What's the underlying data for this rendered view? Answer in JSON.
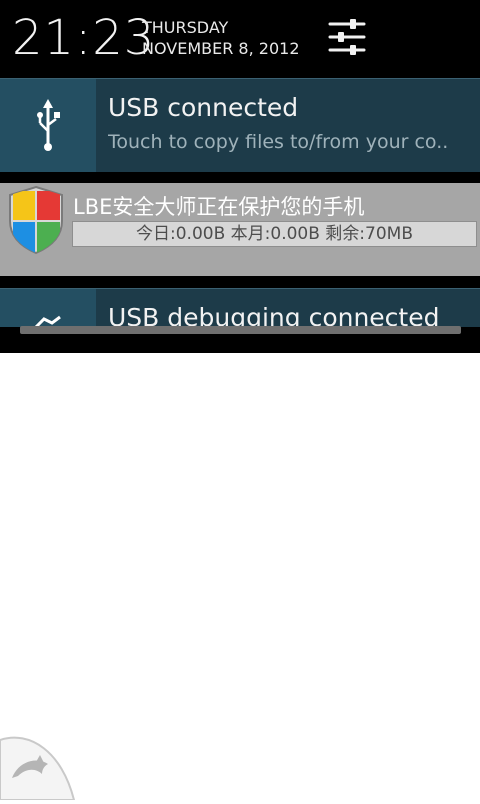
{
  "status_header": {
    "time": "21:23",
    "weekday": "THURSDAY",
    "date": "NOVEMBER 8, 2012",
    "settings_icon": "quick-settings-sliders-icon"
  },
  "notifications": [
    {
      "icon": "usb-icon",
      "title": "USB connected",
      "text": "Touch to copy files to/from your co.."
    },
    {
      "icon": "shield-icon",
      "title": "LBE安全大师正在保护您的手机",
      "text": "今日:0.00B 本月:0.00B 剩余:70MB"
    },
    {
      "icon": "usb-debug-icon",
      "title": "USB debugging connected"
    }
  ],
  "corner_app": {
    "icon": "dolphin-icon"
  },
  "colors": {
    "shade_bg": "#000000",
    "notification_bg": "#1d3b49",
    "notification_icon_bg": "#244f62",
    "lbe_bg": "#a6a6a6",
    "shield_blue": "#1d8fe3",
    "shield_red": "#e53935",
    "shield_green": "#4caf50",
    "shield_yellow": "#f5c518"
  }
}
